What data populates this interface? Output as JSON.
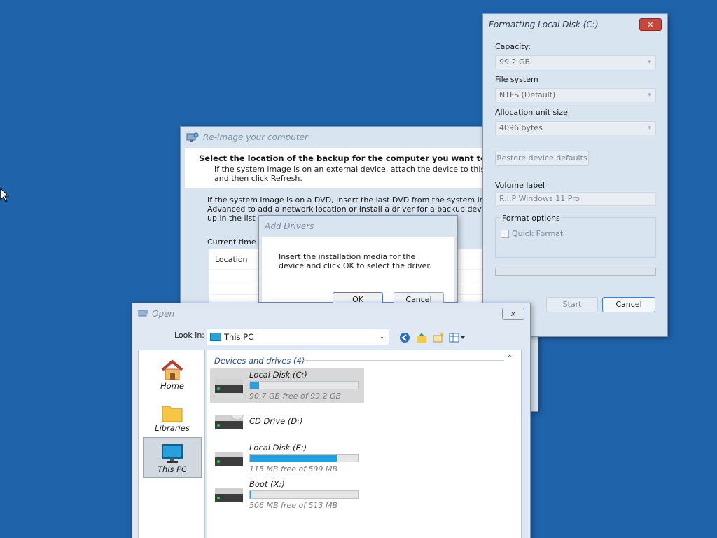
{
  "reimage": {
    "title": "Re-image your computer",
    "heading": "Select the location of the backup for the computer you want to restore",
    "sub_line1": "If the system image is on an external device, attach the device to this computer",
    "sub_line2": "and then click Refresh.",
    "body_line1": "If the system image is on a DVD, insert the last DVD from the system image backu",
    "body_line2": "Advanced to add a network location or install a driver for a backup device if it doe",
    "body_line3": "up in the list bel",
    "timezone_label": "Current time zo",
    "location_header": "Location"
  },
  "add_drivers": {
    "title": "Add Drivers",
    "message": "Insert the installation media for the device and click OK to select the driver.",
    "ok_label": "OK",
    "cancel_label": "Cancel"
  },
  "format": {
    "title": "Formatting Local Disk (C:)",
    "capacity_label": "Capacity:",
    "capacity_value": "99.2 GB",
    "filesystem_label": "File system",
    "filesystem_value": "NTFS (Default)",
    "allocation_label": "Allocation unit size",
    "allocation_value": "4096 bytes",
    "restore_defaults_label": "Restore device defaults",
    "volume_label_label": "Volume label",
    "volume_label_value": "R.I.P Windows 11 Pro",
    "format_options_label": "Format options",
    "quick_format_label": "Quick Format",
    "quick_format_checked": false,
    "start_label": "Start",
    "cancel_label": "Cancel",
    "progress": 0
  },
  "open_dialog": {
    "title": "Open",
    "look_in_label": "Look in:",
    "look_in_value": "This PC",
    "places": [
      {
        "label": "Home",
        "icon": "home-icon"
      },
      {
        "label": "Libraries",
        "icon": "folder-icon"
      },
      {
        "label": "This PC",
        "icon": "monitor-icon",
        "selected": true
      }
    ],
    "group_header": "Devices and drives (4)",
    "drives": [
      {
        "name": "Local Disk (C:)",
        "free_text": "90.7 GB free of 99.2 GB",
        "used_fraction": 0.086,
        "selected": true
      },
      {
        "name": "CD Drive (D:)",
        "free_text": "",
        "used_fraction": null
      },
      {
        "name": "Local Disk (E:)",
        "free_text": "115 MB free of 599 MB",
        "used_fraction": 0.808
      },
      {
        "name": "Boot (X:)",
        "free_text": "506 MB free of 513 MB",
        "used_fraction": 0.014
      }
    ]
  },
  "colors": {
    "desktop": "#1f63ab",
    "progress_fill": "#27a0dc",
    "close_red": "#c9463d"
  }
}
